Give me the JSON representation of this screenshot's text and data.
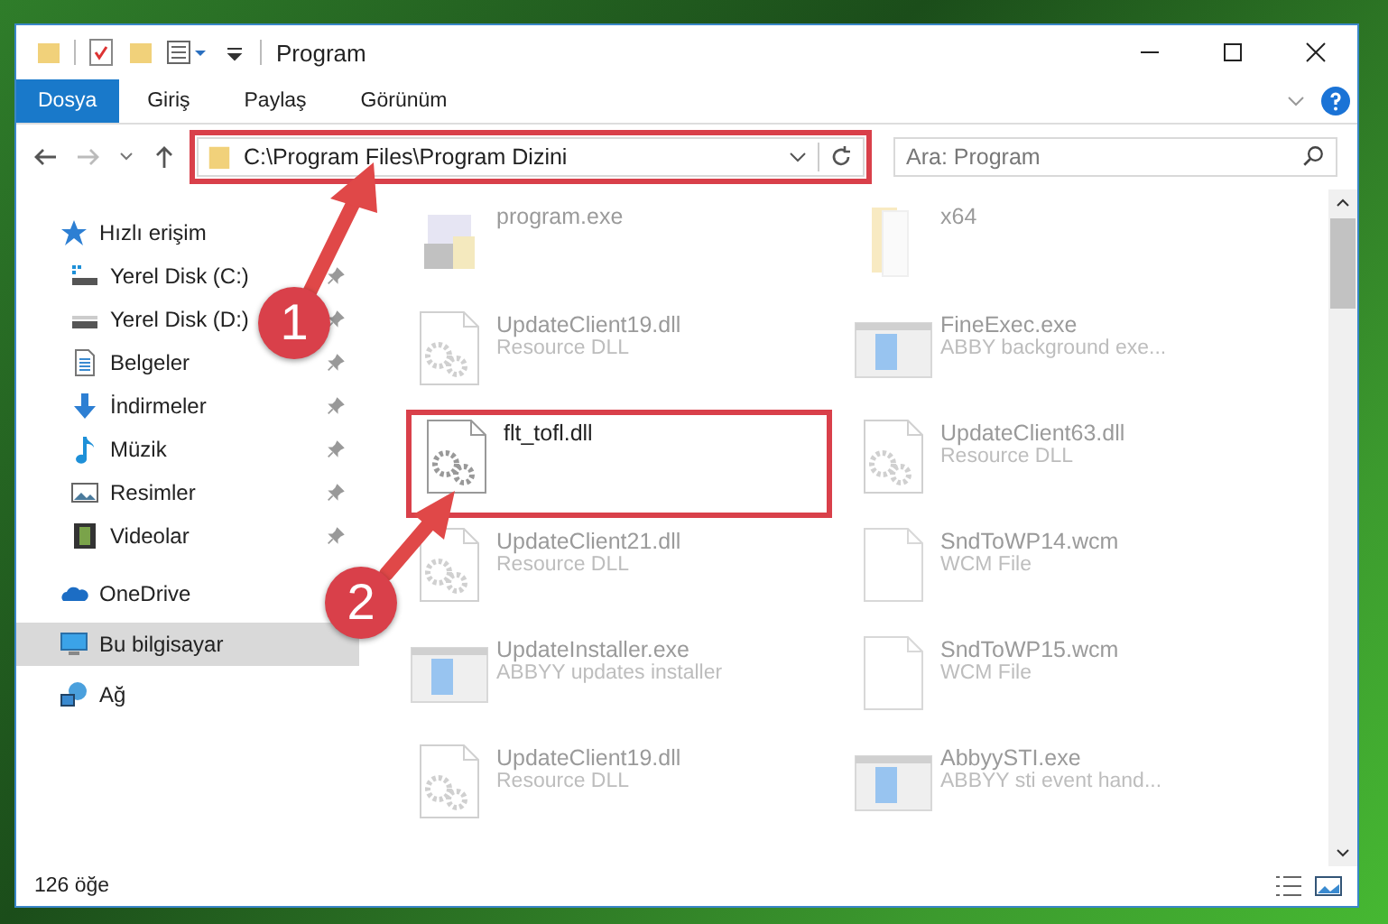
{
  "window": {
    "title": "Program"
  },
  "ribbon_tabs": [
    {
      "label": "Dosya",
      "selected": true
    },
    {
      "label": "Giriş",
      "selected": false
    },
    {
      "label": "Paylaş",
      "selected": false
    },
    {
      "label": "Görünüm",
      "selected": false
    }
  ],
  "address_bar": {
    "path": "C:\\Program Files\\Program Dizini",
    "highlighted": true
  },
  "search": {
    "placeholder": "Ara: Program"
  },
  "sidebar": {
    "items": [
      {
        "label": "Hızlı erişim",
        "kind": "star",
        "selected": false,
        "children": [
          {
            "label": "Yerel Disk (C:)",
            "kind": "drive-c",
            "pinned": true
          },
          {
            "label": "Yerel Disk (D:)",
            "kind": "drive",
            "pinned": true
          },
          {
            "label": "Belgeler",
            "kind": "document",
            "pinned": true
          },
          {
            "label": "İndirmeler",
            "kind": "download",
            "pinned": true
          },
          {
            "label": "Müzik",
            "kind": "music",
            "pinned": true
          },
          {
            "label": "Resimler",
            "kind": "pictures",
            "pinned": true
          },
          {
            "label": "Videolar",
            "kind": "video",
            "pinned": true
          }
        ]
      },
      {
        "label": "OneDrive",
        "kind": "cloud",
        "selected": false
      },
      {
        "label": "Bu bilgisayar",
        "kind": "computer",
        "selected": true
      },
      {
        "label": "Ağ",
        "kind": "network",
        "selected": false
      }
    ]
  },
  "files": [
    {
      "name": "program.exe",
      "kind": "installer",
      "highlighted": false
    },
    {
      "name": "x64",
      "kind": "folder",
      "highlighted": false
    },
    {
      "name": "UpdateClient19.dll",
      "description": "Resource DLL",
      "kind": "dll",
      "highlighted": false
    },
    {
      "name": "FineExec.exe",
      "description": "ABBY background exe...",
      "kind": "exe",
      "highlighted": false
    },
    {
      "name": "flt_tofl.dll",
      "kind": "dll",
      "highlighted": true
    },
    {
      "name": "UpdateClient63.dll",
      "description": "Resource DLL",
      "kind": "dll",
      "highlighted": false
    },
    {
      "name": "UpdateClient21.dll",
      "description": "Resource DLL",
      "kind": "dll",
      "highlighted": false
    },
    {
      "name": "SndToWP14.wcm",
      "description": "WCM File",
      "kind": "file",
      "highlighted": false
    },
    {
      "name": "UpdateInstaller.exe",
      "description": "ABBYY updates installer",
      "kind": "exe",
      "highlighted": false
    },
    {
      "name": "SndToWP15.wcm",
      "description": "WCM File",
      "kind": "file",
      "highlighted": false
    },
    {
      "name": "UpdateClient19.dll",
      "description": "Resource DLL",
      "kind": "dll",
      "highlighted": false
    },
    {
      "name": "AbbyySTI.exe",
      "description": "ABBYY sti event hand...",
      "kind": "exe",
      "highlighted": false
    }
  ],
  "annotations": [
    {
      "label": "1"
    },
    {
      "label": "2"
    }
  ],
  "status_bar": {
    "item_count": "126 öğe"
  }
}
